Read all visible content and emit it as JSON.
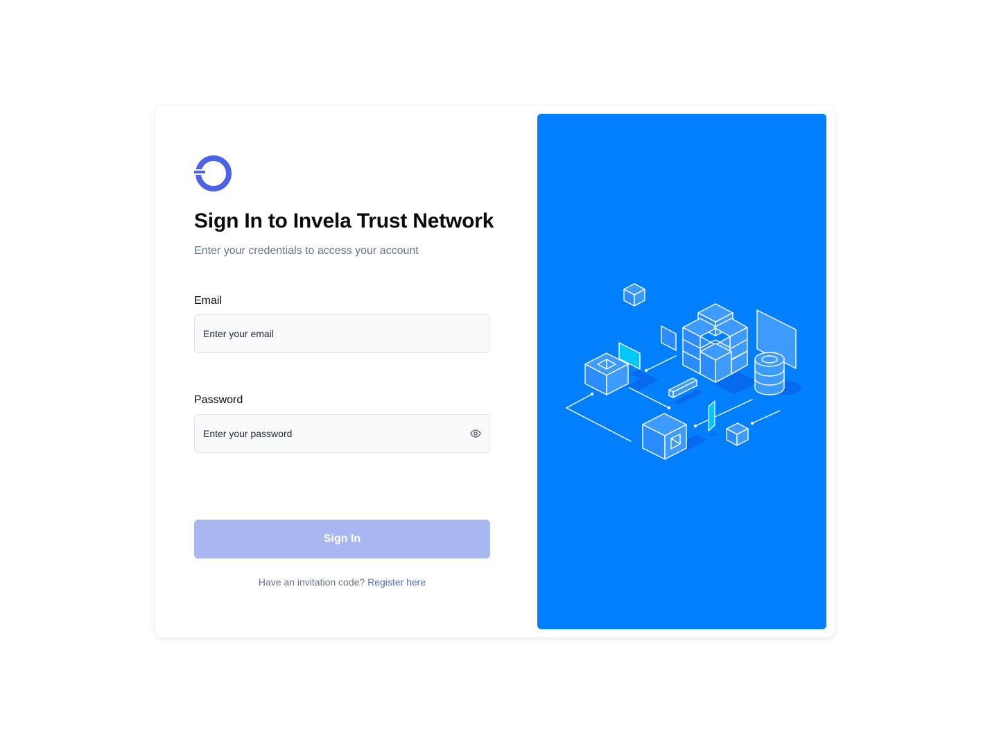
{
  "brand": {
    "logo_icon": "invela-ring-logo-icon",
    "accent_color": "#4a63e7"
  },
  "header": {
    "title": "Sign In to Invela Trust Network",
    "subtitle": "Enter your credentials to access your account"
  },
  "form": {
    "email": {
      "label": "Email",
      "value": "",
      "placeholder": "Enter your email"
    },
    "password": {
      "label": "Password",
      "value": "",
      "placeholder": "Enter your password",
      "toggle_icon": "eye-icon"
    },
    "submit_label": "Sign In",
    "submit_color": "#a8b7f0"
  },
  "footer": {
    "prompt": "Have an invitation code?",
    "link_label": "Register here",
    "link_color": "#4a6de5"
  },
  "illustration": {
    "background_color": "#0080ff",
    "icon": "isometric-network-cubes-illustration"
  }
}
